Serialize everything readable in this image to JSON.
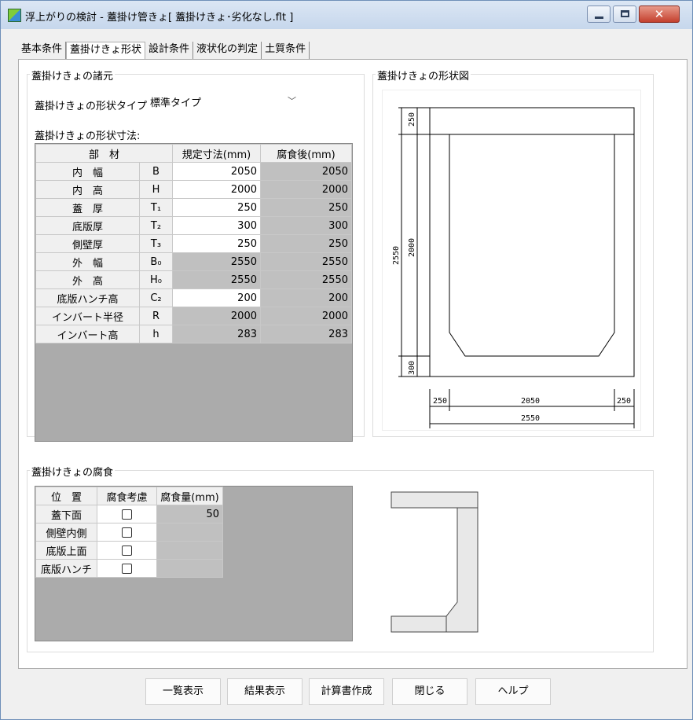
{
  "window": {
    "title": "浮上がりの検討 - 蓋掛け管きょ[ 蓋掛けきょ･劣化なし.flt ]",
    "close_glyph": "✕"
  },
  "tabs": [
    {
      "label": "基本条件",
      "active": false
    },
    {
      "label": "蓋掛けきょ形状",
      "active": true
    },
    {
      "label": "設計条件",
      "active": false
    },
    {
      "label": "液状化の判定",
      "active": false
    },
    {
      "label": "土質条件",
      "active": false
    }
  ],
  "specs": {
    "group_title": "蓋掛けきょの諸元",
    "shape_type_label": "蓋掛けきょの形状タイプ:",
    "shape_type_value": "標準タイプ",
    "dims_label": "蓋掛けきょの形状寸法:",
    "table": {
      "headers": [
        "部　材",
        "規定寸法(mm)",
        "腐食後(mm)"
      ],
      "rows": [
        {
          "name": "内　幅",
          "sym": "B",
          "spec": "2050",
          "after": "2050",
          "editable": true
        },
        {
          "name": "内　高",
          "sym": "H",
          "spec": "2000",
          "after": "2000",
          "editable": true
        },
        {
          "name": "蓋　厚",
          "sym": "T₁",
          "spec": "250",
          "after": "250",
          "editable": true
        },
        {
          "name": "底版厚",
          "sym": "T₂",
          "spec": "300",
          "after": "300",
          "editable": true
        },
        {
          "name": "側壁厚",
          "sym": "T₃",
          "spec": "250",
          "after": "250",
          "editable": true
        },
        {
          "name": "外　幅",
          "sym": "B₀",
          "spec": "2550",
          "after": "2550",
          "editable": false
        },
        {
          "name": "外　高",
          "sym": "H₀",
          "spec": "2550",
          "after": "2550",
          "editable": false
        },
        {
          "name": "底版ハンチ高",
          "sym": "C₂",
          "spec": "200",
          "after": "200",
          "editable": true
        },
        {
          "name": "インバート半径",
          "sym": "R",
          "spec": "2000",
          "after": "2000",
          "editable": false
        },
        {
          "name": "インバート高",
          "sym": "h",
          "spec": "283",
          "after": "283",
          "editable": false
        }
      ]
    }
  },
  "shape_diagram": {
    "group_title": "蓋掛けきょの形状図",
    "dims": {
      "cover": "250",
      "total_height": "2550",
      "inner_height": "2000",
      "bottom": "300",
      "wall_left": "250",
      "inner_width": "2050",
      "wall_right": "250",
      "total_width": "2550"
    }
  },
  "corrosion": {
    "group_title": "蓋掛けきょの腐食",
    "headers": [
      "位　置",
      "腐食考慮",
      "腐食量(mm)"
    ],
    "rows": [
      {
        "position": "蓋下面",
        "checked": false,
        "amount": "50"
      },
      {
        "position": "側壁内側",
        "checked": false,
        "amount": ""
      },
      {
        "position": "底版上面",
        "checked": false,
        "amount": ""
      },
      {
        "position": "底版ハンチ",
        "checked": false,
        "amount": ""
      }
    ]
  },
  "buttons": {
    "list": "一覧表示",
    "result": "結果表示",
    "report": "計算書作成",
    "close": "閉じる",
    "help": "ヘルプ"
  },
  "colors": {
    "readonly_cell": "#c0c0c0",
    "grid_empty": "#ababab",
    "close_button": "#c4402e"
  }
}
